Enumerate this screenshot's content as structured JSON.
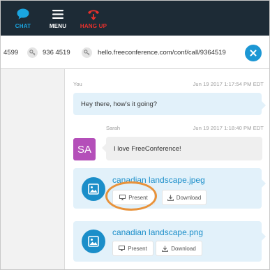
{
  "toolbar": {
    "chat_label": "CHAT",
    "menu_label": "MENU",
    "hangup_label": "HANG UP",
    "chat_icon": "chat-bubble-icon",
    "menu_icon": "hamburger-icon",
    "hangup_icon": "phone-hangup-icon",
    "colors": {
      "background": "#1d2b36",
      "chat": "#1aa5e0",
      "hangup": "#e8302c"
    }
  },
  "info": {
    "code_partial": "4599",
    "pin": "936 4519",
    "link": "hello.freeconference.com/conf/call/9364519",
    "key_icon": "key-icon",
    "link_icon": "link-icon",
    "close_icon": "close-icon"
  },
  "messages": [
    {
      "sender": "You",
      "time": "Jun 19 2017 1:17:54 PM EDT",
      "text": "Hey there, how's it going?"
    },
    {
      "sender": "Sarah",
      "avatar_initials": "SA",
      "time": "Jun 19 2017 1:18:40 PM EDT",
      "text": "I love FreeConference!"
    }
  ],
  "files": [
    {
      "name": "canadian landscape.jpeg",
      "present_label": "Present",
      "download_label": "Download"
    },
    {
      "name": "canadian landscape.png",
      "present_label": "Present",
      "download_label": "Download"
    }
  ],
  "colors": {
    "accent": "#1b8ec9",
    "avatar": "#b44fb9",
    "bubble_self": "#e2f1fa",
    "highlight": "#e8923a"
  }
}
